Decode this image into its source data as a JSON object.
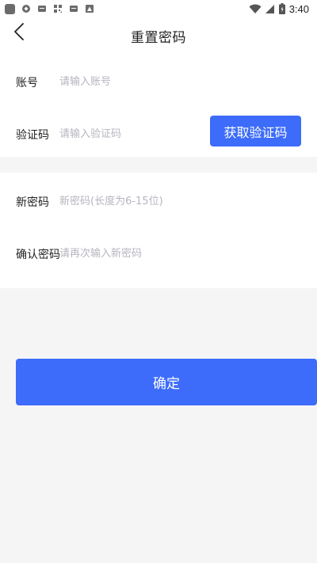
{
  "status_bar": {
    "time": "3:40",
    "left_icons": [
      "app-icon",
      "sync-icon",
      "message-icon",
      "qr-icon",
      "message-icon",
      "image-icon"
    ],
    "right_icons": [
      "wifi-icon",
      "signal-icon",
      "battery-icon"
    ]
  },
  "header": {
    "title": "重置密码",
    "back_icon": "chevron-left-icon"
  },
  "form": {
    "account": {
      "label": "账号",
      "placeholder": "请输入账号",
      "value": ""
    },
    "code": {
      "label": "验证码",
      "placeholder": "请输入验证码",
      "value": "",
      "button_label": "获取验证码"
    },
    "new_password": {
      "label": "新密码",
      "placeholder": "新密码(长度为6-15位)",
      "value": ""
    },
    "confirm_password": {
      "label": "确认密码",
      "placeholder": "请再次输入新密码",
      "value": ""
    }
  },
  "confirm_button": {
    "label": "确定"
  },
  "colors": {
    "accent": "#3d6cfa",
    "background": "#f5f5f5",
    "card": "#ffffff",
    "placeholder": "#b5b5c0"
  }
}
